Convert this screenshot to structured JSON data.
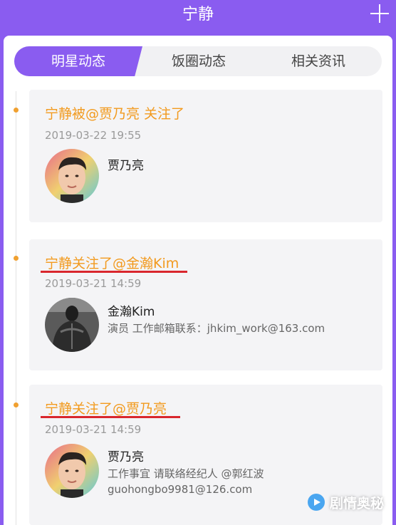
{
  "header": {
    "title": "宁静",
    "add_icon": "plus-icon"
  },
  "tabs": [
    {
      "label": "明星动态",
      "active": true
    },
    {
      "label": "饭圈动态",
      "active": false
    },
    {
      "label": "相关资讯",
      "active": false
    }
  ],
  "feed": [
    {
      "title": "宁静被@贾乃亮 关注了",
      "time": "2019-03-22 19:55",
      "user": {
        "name": "贾乃亮",
        "desc": ""
      }
    },
    {
      "title": "宁静关注了@金瀚Kim",
      "time": "2019-03-21 14:59",
      "user": {
        "name": "金瀚Kim",
        "desc": "演员  工作邮箱联系：jhkim_work@163.com"
      }
    },
    {
      "title": "宁静关注了@贾乃亮",
      "time": "2019-03-21 14:59",
      "user": {
        "name": "贾乃亮",
        "desc": "工作事宜  请联络经纪人  @郭红波",
        "desc2": "guohongbo9981@126.com"
      }
    }
  ],
  "watermark": {
    "text": "剧情奥秘"
  },
  "colors": {
    "accent": "#8a5cf0",
    "highlight": "#f29a1e",
    "underline": "#d9262d"
  }
}
